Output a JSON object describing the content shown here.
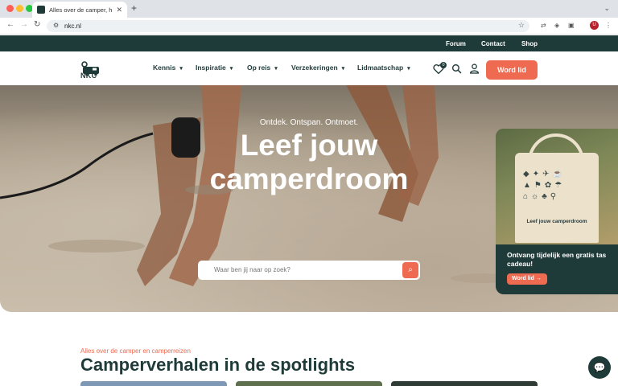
{
  "browser": {
    "tab_title": "Alles over de camper, het ca",
    "url": "nkc.nl",
    "profile_initial": "U"
  },
  "topbar": {
    "links": [
      "Forum",
      "Contact",
      "Shop"
    ]
  },
  "nav": {
    "logo_text": "NKC",
    "items": [
      "Kennis",
      "Inspiratie",
      "Op reis",
      "Verzekeringen",
      "Lidmaatschap"
    ],
    "favorites_count": "0",
    "cta_label": "Word lid"
  },
  "hero": {
    "tagline": "Ontdek. Ontspan. Ontmoet.",
    "headline_line1": "Leef jouw",
    "headline_line2": "camperdroom",
    "search_placeholder": "Waar ben jij naar op zoek?"
  },
  "promo": {
    "bag_text": "Leef jouw camperdroom",
    "text": "Ontvang tijdelijk een gratis tas cadeau!",
    "button_label": "Word lid"
  },
  "section": {
    "subtitle": "Alles over de camper en camperreizen",
    "title": "Camperverhalen in de spotlights"
  },
  "colors": {
    "brand_dark": "#1f3b39",
    "accent": "#ee6a50"
  }
}
